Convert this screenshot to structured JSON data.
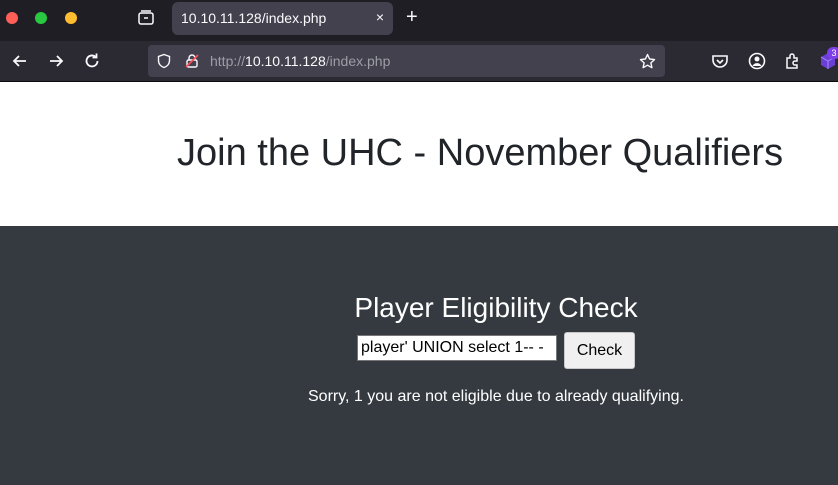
{
  "browser": {
    "tab_title": "10.10.11.128/index.php",
    "tab_close": "×",
    "new_tab": "+",
    "url_scheme": "http://",
    "url_host": "10.10.11.128",
    "url_path": "/index.php",
    "extension_badge": "3"
  },
  "page": {
    "title": "Join the UHC - November Qualifiers",
    "section_title": "Player Eligibility Check",
    "input_value": "player' UNION select 1-- -",
    "check_button": "Check",
    "result_message": "Sorry, 1 you are not eligible due to already qualifying."
  }
}
